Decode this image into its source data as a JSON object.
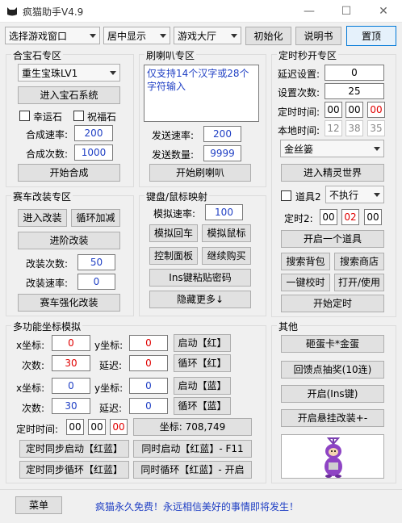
{
  "window": {
    "title": "疯猫助手V4.9",
    "minimize": "—",
    "maximize": "☐",
    "close": "✕"
  },
  "toolbar": {
    "game_window": "选择游戏窗口",
    "position": "居中显示",
    "lobby": "游戏大厅",
    "init": "初始化",
    "manual": "说明书",
    "skin": "置顶"
  },
  "gem": {
    "title": "合宝石专区",
    "select": "重生宝珠LV1",
    "enter": "进入宝石系统",
    "lucky": "幸运石",
    "bless": "祝福石",
    "speed_label": "合成速率:",
    "speed": "200",
    "count_label": "合成次数:",
    "count": "1000",
    "start": "开始合成"
  },
  "horn": {
    "title": "刷喇叭专区",
    "text": "仅支持14个汉字或28个字符输入",
    "speed_label": "发送速率:",
    "speed": "200",
    "count_label": "发送数量:",
    "count": "9999",
    "start": "开始刷喇叭"
  },
  "timer": {
    "title": "定时秒开专区",
    "delay_label": "延迟设置:",
    "delay": "0",
    "times_label": "设置次数:",
    "times": "25",
    "time_label": "定时时间:",
    "h": "00",
    "m": "00",
    "s": "00",
    "local_label": "本地时间:",
    "lh": "12",
    "lm": "38",
    "ls": "35",
    "select": "金丝篓",
    "enter": "进入精灵世界",
    "prop2": "道具2",
    "prop2_sel": "不执行",
    "timer2_label": "定时2:",
    "t2h": "00",
    "t2m": "02",
    "t2s": "00",
    "open_prop": "开启一个道具",
    "search_bag": "搜索背包",
    "search_shop": "搜索商店",
    "calibrate": "一键校时",
    "open_use": "打开/使用",
    "start": "开始定时"
  },
  "car": {
    "title": "赛车改装专区",
    "enter": "进入改装",
    "cycle": "循环加减",
    "advance": "进阶改装",
    "times_label": "改装次数:",
    "times": "50",
    "speed_label": "改装速率:",
    "speed": "0",
    "strong": "赛车强化改装"
  },
  "key": {
    "title": "键盘/鼠标映射",
    "speed_label": "模拟速率:",
    "speed": "100",
    "back": "模拟回车",
    "mouse": "模拟鼠标",
    "panel": "控制面板",
    "buy": "继续购买",
    "ins": "Ins键粘贴密码",
    "hide": "隐藏更多↓"
  },
  "multi": {
    "title": "多功能坐标模拟",
    "x": "x坐标:",
    "y": "y坐标:",
    "count": "次数:",
    "delay": "延迟:",
    "r_x": "0",
    "r_y": "0",
    "r_count": "30",
    "r_delay": "0",
    "start_red": "启动【红】",
    "loop_red": "循环【红】",
    "b_x": "0",
    "b_y": "0",
    "b_count": "30",
    "b_delay": "0",
    "start_blue": "启动【蓝】",
    "loop_blue": "循环【蓝】",
    "time_label": "定时时间:",
    "h": "00",
    "m": "00",
    "s": "00",
    "coord": "坐标: 708,749",
    "sync_start": "定时同步启动【红蓝】",
    "sync_start2": "同时启动【红蓝】- F11",
    "sync_loop": "定时同步循环【红蓝】",
    "sync_loop2": "同时循环【红蓝】- 开启"
  },
  "other": {
    "title": "其他",
    "b1": "砸蛋卡*金蛋",
    "b2": "回馈点抽奖(10连)",
    "b3": "开启(Ins键)",
    "b4": "开启悬挂改装+-"
  },
  "footer": {
    "menu": "菜单",
    "message": "疯猫永久免费！永远相信美好的事情即将发生！"
  },
  "colors": {
    "accent": "#0078d7",
    "blue_text": "#1f3fc4",
    "red_text": "#e00000"
  }
}
